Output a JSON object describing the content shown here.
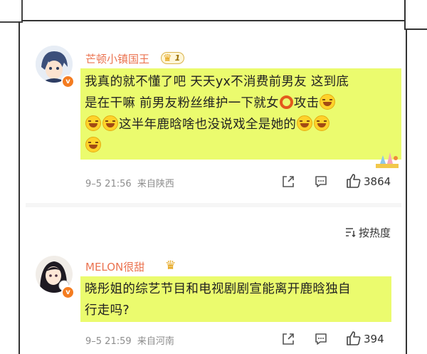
{
  "sort": {
    "label": "按热度"
  },
  "comments": [
    {
      "username": "芒顿小镇国王",
      "level": "1",
      "lines": [
        "我真的就不懂了吧 天天yx不消费前男友 这到底",
        "是在干嘛 前男友粉丝维护一下就女",
        "攻击",
        "这半年鹿晗啥也没说戏全是她的"
      ],
      "time": "9–5 21:56",
      "source": "来自陕西",
      "likes": "3864"
    },
    {
      "username": "MELON很甜",
      "lines": [
        "晓彤姐的综艺节目和电视剧剧宣能离开鹿晗独自",
        "行走吗?"
      ],
      "time": "9–5 21:59",
      "source": "来自河南",
      "likes": "394"
    }
  ],
  "colors": {
    "username": "#eb7350",
    "highlight": "#ebfb6e",
    "meta": "#8d8d8d"
  }
}
